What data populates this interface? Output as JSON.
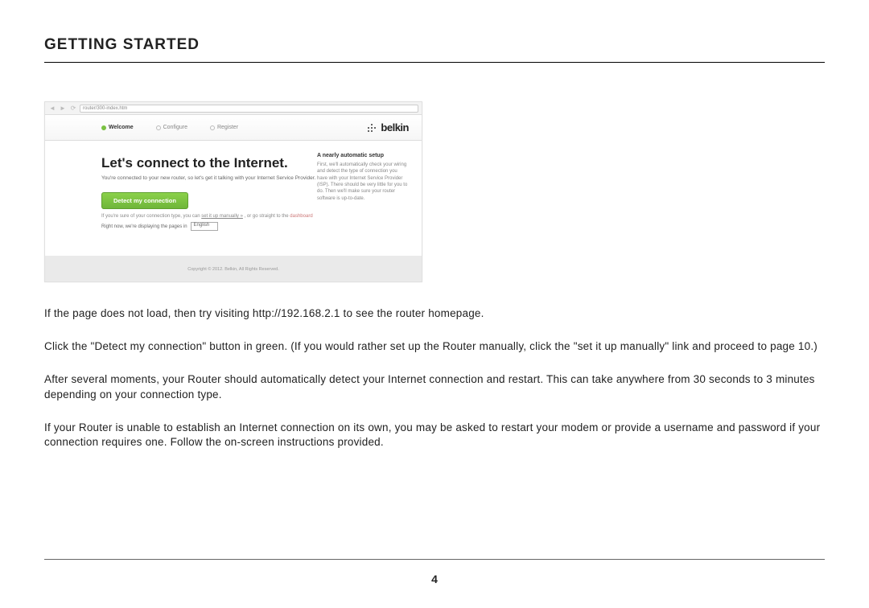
{
  "page": {
    "title": "GETTING STARTED",
    "number": "4"
  },
  "screenshot": {
    "url": "router/300-index.htm",
    "steps": {
      "welcome": "Welcome",
      "configure": "Configure",
      "register": "Register"
    },
    "brand": "belkin",
    "heading": "Let's connect to the Internet.",
    "subheading": "You're connected to your new router, so let's get it talking with your Internet Service Provider.",
    "button": "Detect my connection",
    "manual_line_prefix": "If you're sure of your connection type, you can ",
    "manual_link": "set it up manually »",
    "manual_line_mid": " , or go straight to the ",
    "dashboard_link": "dashboard",
    "lang_label": "Right now, we're displaying the pages in",
    "lang_value": "English",
    "sidebar_title": "A nearly automatic setup",
    "sidebar_body": "First, we'll automatically check your wiring and detect the type of connection you have with your Internet Service Provider (ISP). There should be very little for you to do. Then we'll make sure your router software is up-to-date.",
    "copyright": "Copyright © 2012. Belkin, All Rights Reserved."
  },
  "body": {
    "p1": "If the page does not load, then try visiting http://192.168.2.1 to see the router homepage.",
    "p2": "Click the \"Detect my connection\" button in green. (If you would rather set up the Router manually, click the \"set it up manually\" link and proceed to page 10.)",
    "p3": "After several moments, your Router should automatically detect your Internet connection and restart. This can take anywhere from 30 seconds to 3 minutes depending on your connection type.",
    "p4": "If your Router is unable to establish an Internet connection on its own, you may be asked to restart your modem or provide a username and password if your connection requires one. Follow the on-screen instructions provided."
  }
}
